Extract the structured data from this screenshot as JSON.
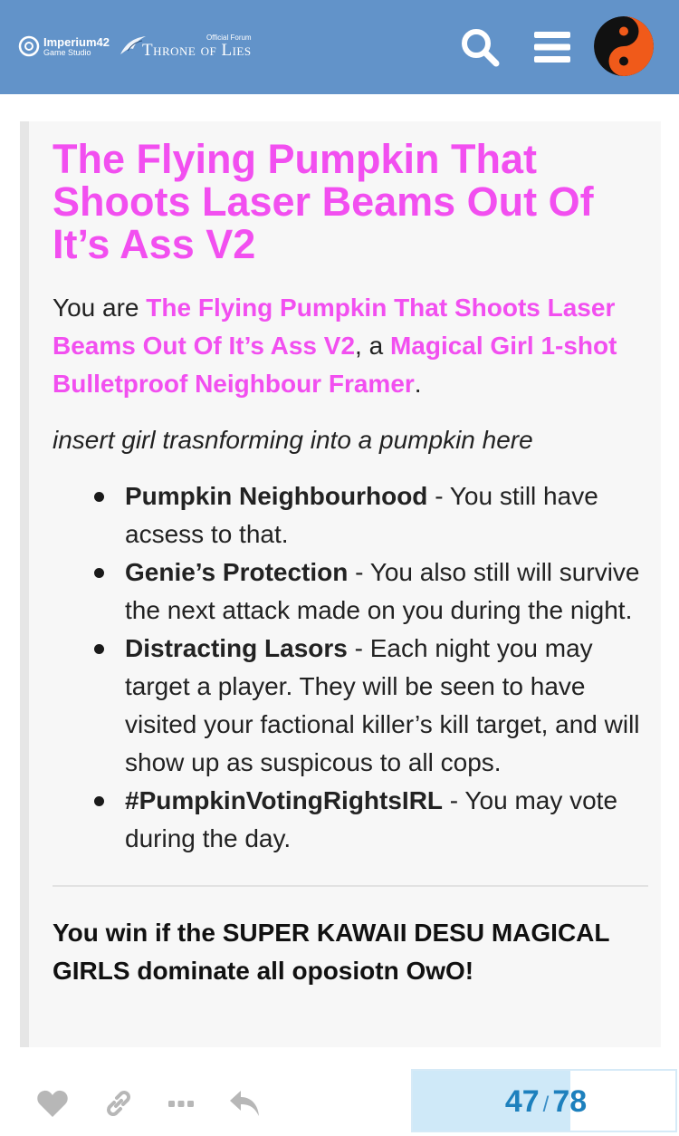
{
  "header": {
    "studio_name": "Imperium42",
    "studio_sub": "Game Studio",
    "forum_tag": "Official Forum",
    "forum_name": "Throne of Lies",
    "search_icon": "search-icon",
    "menu_icon": "hamburger-menu-icon",
    "avatar_icon": "yin-yang-avatar",
    "bg_color": "#6293c9"
  },
  "post": {
    "title": "The Flying Pumpkin That Shoots Laser Beams Out Of It’s Ass V2",
    "intro_prefix": "You are ",
    "intro_role": "The Flying Pumpkin That Shoots Laser Beams Out Of It’s Ass V2",
    "intro_mid": ", a ",
    "intro_class": "Magical Girl 1-shot Bulletproof Neighbour Framer",
    "intro_suffix": ".",
    "flavor": "insert girl trasnforming into a pumpkin here",
    "abilities": [
      {
        "name": "Pumpkin Neighbourhood",
        "text": " - You still have acsess to that."
      },
      {
        "name": "Genie’s Protection",
        "text": " - You also still will survive the next attack made on you during the night."
      },
      {
        "name": "Distracting Lasors",
        "text": " - Each night you may target a player. They will be seen to have visited your factional killer’s kill target, and will show up as suspicous to all cops."
      },
      {
        "name": "#PumpkinVotingRightsIRL",
        "text": " - You may vote during the day."
      }
    ],
    "win_condition": "You win if the SUPER KAWAII DESU MAGICAL GIRLS dominate all oposiotn OwO!",
    "accent_color": "#f24ff0"
  },
  "footer": {
    "icons": [
      "heart-icon",
      "link-icon",
      "more-icon",
      "reply-icon"
    ],
    "progress_current": "47",
    "progress_separator": "/",
    "progress_total": "78",
    "progress_fraction": 0.6,
    "progress_color": "#1d80bd"
  }
}
